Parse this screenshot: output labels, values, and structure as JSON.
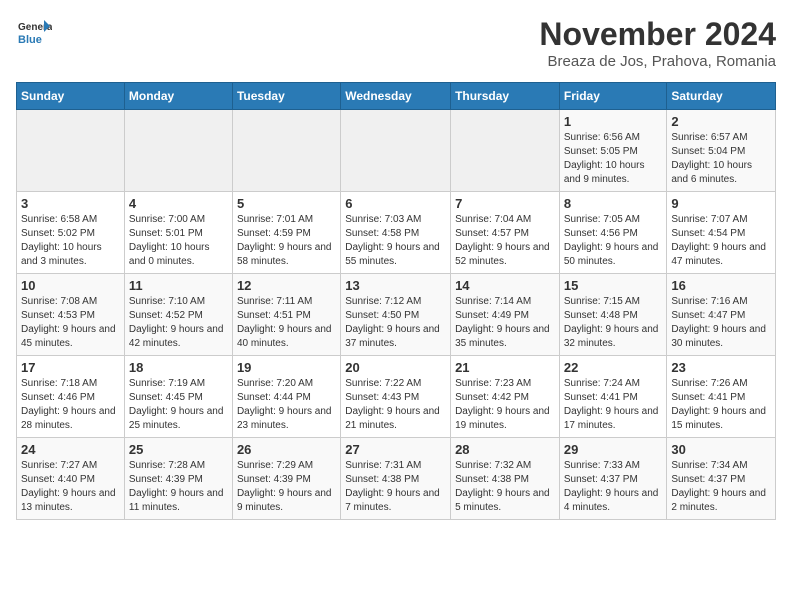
{
  "header": {
    "logo_line1": "General",
    "logo_line2": "Blue",
    "month": "November 2024",
    "location": "Breaza de Jos, Prahova, Romania"
  },
  "days_of_week": [
    "Sunday",
    "Monday",
    "Tuesday",
    "Wednesday",
    "Thursday",
    "Friday",
    "Saturday"
  ],
  "weeks": [
    [
      {
        "day": "",
        "info": ""
      },
      {
        "day": "",
        "info": ""
      },
      {
        "day": "",
        "info": ""
      },
      {
        "day": "",
        "info": ""
      },
      {
        "day": "",
        "info": ""
      },
      {
        "day": "1",
        "info": "Sunrise: 6:56 AM\nSunset: 5:05 PM\nDaylight: 10 hours and 9 minutes."
      },
      {
        "day": "2",
        "info": "Sunrise: 6:57 AM\nSunset: 5:04 PM\nDaylight: 10 hours and 6 minutes."
      }
    ],
    [
      {
        "day": "3",
        "info": "Sunrise: 6:58 AM\nSunset: 5:02 PM\nDaylight: 10 hours and 3 minutes."
      },
      {
        "day": "4",
        "info": "Sunrise: 7:00 AM\nSunset: 5:01 PM\nDaylight: 10 hours and 0 minutes."
      },
      {
        "day": "5",
        "info": "Sunrise: 7:01 AM\nSunset: 4:59 PM\nDaylight: 9 hours and 58 minutes."
      },
      {
        "day": "6",
        "info": "Sunrise: 7:03 AM\nSunset: 4:58 PM\nDaylight: 9 hours and 55 minutes."
      },
      {
        "day": "7",
        "info": "Sunrise: 7:04 AM\nSunset: 4:57 PM\nDaylight: 9 hours and 52 minutes."
      },
      {
        "day": "8",
        "info": "Sunrise: 7:05 AM\nSunset: 4:56 PM\nDaylight: 9 hours and 50 minutes."
      },
      {
        "day": "9",
        "info": "Sunrise: 7:07 AM\nSunset: 4:54 PM\nDaylight: 9 hours and 47 minutes."
      }
    ],
    [
      {
        "day": "10",
        "info": "Sunrise: 7:08 AM\nSunset: 4:53 PM\nDaylight: 9 hours and 45 minutes."
      },
      {
        "day": "11",
        "info": "Sunrise: 7:10 AM\nSunset: 4:52 PM\nDaylight: 9 hours and 42 minutes."
      },
      {
        "day": "12",
        "info": "Sunrise: 7:11 AM\nSunset: 4:51 PM\nDaylight: 9 hours and 40 minutes."
      },
      {
        "day": "13",
        "info": "Sunrise: 7:12 AM\nSunset: 4:50 PM\nDaylight: 9 hours and 37 minutes."
      },
      {
        "day": "14",
        "info": "Sunrise: 7:14 AM\nSunset: 4:49 PM\nDaylight: 9 hours and 35 minutes."
      },
      {
        "day": "15",
        "info": "Sunrise: 7:15 AM\nSunset: 4:48 PM\nDaylight: 9 hours and 32 minutes."
      },
      {
        "day": "16",
        "info": "Sunrise: 7:16 AM\nSunset: 4:47 PM\nDaylight: 9 hours and 30 minutes."
      }
    ],
    [
      {
        "day": "17",
        "info": "Sunrise: 7:18 AM\nSunset: 4:46 PM\nDaylight: 9 hours and 28 minutes."
      },
      {
        "day": "18",
        "info": "Sunrise: 7:19 AM\nSunset: 4:45 PM\nDaylight: 9 hours and 25 minutes."
      },
      {
        "day": "19",
        "info": "Sunrise: 7:20 AM\nSunset: 4:44 PM\nDaylight: 9 hours and 23 minutes."
      },
      {
        "day": "20",
        "info": "Sunrise: 7:22 AM\nSunset: 4:43 PM\nDaylight: 9 hours and 21 minutes."
      },
      {
        "day": "21",
        "info": "Sunrise: 7:23 AM\nSunset: 4:42 PM\nDaylight: 9 hours and 19 minutes."
      },
      {
        "day": "22",
        "info": "Sunrise: 7:24 AM\nSunset: 4:41 PM\nDaylight: 9 hours and 17 minutes."
      },
      {
        "day": "23",
        "info": "Sunrise: 7:26 AM\nSunset: 4:41 PM\nDaylight: 9 hours and 15 minutes."
      }
    ],
    [
      {
        "day": "24",
        "info": "Sunrise: 7:27 AM\nSunset: 4:40 PM\nDaylight: 9 hours and 13 minutes."
      },
      {
        "day": "25",
        "info": "Sunrise: 7:28 AM\nSunset: 4:39 PM\nDaylight: 9 hours and 11 minutes."
      },
      {
        "day": "26",
        "info": "Sunrise: 7:29 AM\nSunset: 4:39 PM\nDaylight: 9 hours and 9 minutes."
      },
      {
        "day": "27",
        "info": "Sunrise: 7:31 AM\nSunset: 4:38 PM\nDaylight: 9 hours and 7 minutes."
      },
      {
        "day": "28",
        "info": "Sunrise: 7:32 AM\nSunset: 4:38 PM\nDaylight: 9 hours and 5 minutes."
      },
      {
        "day": "29",
        "info": "Sunrise: 7:33 AM\nSunset: 4:37 PM\nDaylight: 9 hours and 4 minutes."
      },
      {
        "day": "30",
        "info": "Sunrise: 7:34 AM\nSunset: 4:37 PM\nDaylight: 9 hours and 2 minutes."
      }
    ]
  ]
}
